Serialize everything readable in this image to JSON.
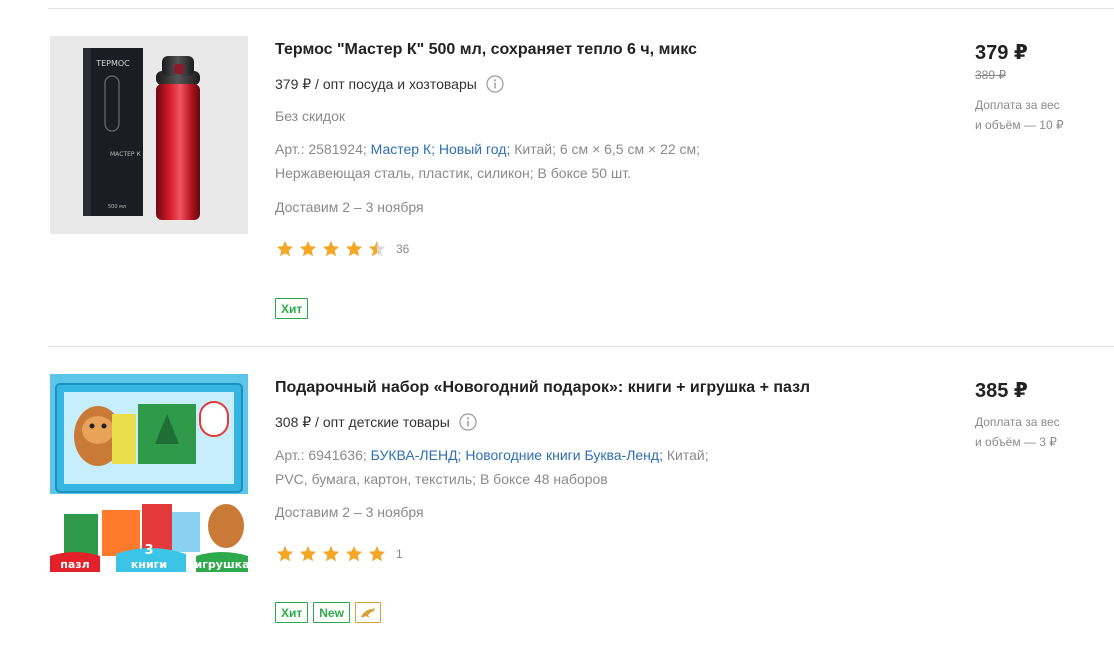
{
  "products": [
    {
      "title": "Термос \"Мастер К\" 500 мл, сохраняет тепло 6 ч, микс",
      "wholesale": "379 ₽ / опт посуда и хозтовары",
      "discount_note": "Без скидок",
      "article": "Арт.: 2581924;",
      "brand": "Мастер К;",
      "collection": "Новый год;",
      "country": "Китай;",
      "size": "6 см × 6,5 см × 22 см;",
      "material": "Нержавеющая сталь, пластик, силикон;",
      "box": "В боксе 50 шт.",
      "delivery": "Доставим 2 – 3 ноября",
      "rating": 4.5,
      "reviews": "36",
      "badges": [
        "Хит"
      ],
      "price": "379 ₽",
      "old_price": "389 ₽",
      "extra_line1": "Доплата за вес",
      "extra_line2": "и объём — 10 ₽",
      "image_text_box": "ТЕРМОС"
    },
    {
      "title": "Подарочный набор «Новогодний подарок»: книги + игрушка + пазл",
      "wholesale": "308 ₽ / опт детские товары",
      "article": "Арт.: 6941636;",
      "brand": "БУКВА-ЛЕНД;",
      "collection": "Новогодние книги Буква-Ленд;",
      "country": "Китай;",
      "material": "PVC, бумага, картон, текстиль;",
      "box": "В боксе 48 наборов",
      "delivery": "Доставим 2 – 3 ноября",
      "rating": 5,
      "reviews": "1",
      "badges": [
        "Хит",
        "New"
      ],
      "price": "385 ₽",
      "extra_line1": "Доплата за вес",
      "extra_line2": "и объём — 3 ₽",
      "image_labels": {
        "puzzle": "пазл",
        "books_count": "3",
        "books": "книги",
        "toy": "игрушка"
      }
    }
  ],
  "colors": {
    "link": "#2f6fb4",
    "star": "#f5a623",
    "badge": "#2eaa4c",
    "muted": "#8a8a8a"
  }
}
